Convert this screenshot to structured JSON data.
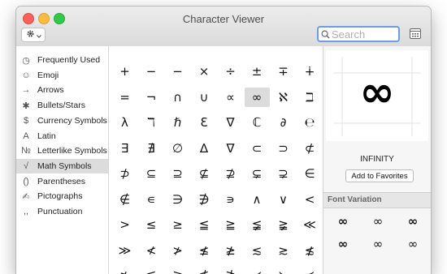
{
  "window": {
    "title": "Character Viewer"
  },
  "toolbar": {
    "search_placeholder": "Search"
  },
  "sidebar": {
    "items": [
      {
        "label": "Frequently Used",
        "icon": "clock-icon",
        "glyph": "◷"
      },
      {
        "label": "Emoji",
        "icon": "smiley-icon",
        "glyph": "☺"
      },
      {
        "label": "Arrows",
        "icon": "arrow-icon",
        "glyph": "→"
      },
      {
        "label": "Bullets/Stars",
        "icon": "asterisk-icon",
        "glyph": "✱"
      },
      {
        "label": "Currency Symbols",
        "icon": "dollar-icon",
        "glyph": "$"
      },
      {
        "label": "Latin",
        "icon": "latin-a-icon",
        "glyph": "A"
      },
      {
        "label": "Letterlike Symbols",
        "icon": "numero-icon",
        "glyph": "№"
      },
      {
        "label": "Math Symbols",
        "icon": "sqrt-icon",
        "glyph": "√"
      },
      {
        "label": "Parentheses",
        "icon": "parentheses-icon",
        "glyph": "()"
      },
      {
        "label": "Pictographs",
        "icon": "pictograph-icon",
        "glyph": "✍"
      },
      {
        "label": "Punctuation",
        "icon": "punctuation-icon",
        "glyph": ",,"
      }
    ],
    "selected_index": 7
  },
  "characters": {
    "rows": [
      [
        "+",
        "−",
        "−",
        "×",
        "÷",
        "±",
        "∓",
        "∔"
      ],
      [
        "=",
        "¬",
        "∩",
        "∪",
        "∝",
        "∞",
        "ℵ",
        "ℶ"
      ],
      [
        "λ",
        "ℸ",
        "ℏ",
        "Ɛ",
        "∇",
        "ℂ",
        "∂",
        "℮"
      ],
      [
        "∃",
        "∄",
        "∅",
        "∆",
        "∇",
        "⊂",
        "⊃",
        "⊄"
      ],
      [
        "⊅",
        "⊆",
        "⊇",
        "⊈",
        "⊉",
        "⊊",
        "⊋",
        "∈"
      ],
      [
        "∉",
        "∊",
        "∋",
        "∌",
        "∍",
        "∧",
        "∨",
        "<"
      ],
      [
        ">",
        "≤",
        "≥",
        "≦",
        "≧",
        "≨",
        "≩",
        "≪"
      ],
      [
        "≫",
        "≮",
        "≯",
        "≰",
        "≱",
        "≲",
        "≳",
        "≴"
      ],
      [
        "≵",
        "≶",
        "≷",
        "≸",
        "≹",
        "≺",
        "≻",
        "≼"
      ]
    ],
    "selected": {
      "row": 1,
      "col": 5
    }
  },
  "detail": {
    "preview_char": "∞",
    "name": "INFINITY",
    "add_favorites_label": "Add to Favorites",
    "font_variation_heading": "Font Variation",
    "variations": [
      "∞",
      "∞",
      "∞",
      "∞",
      "∞",
      "∞"
    ]
  }
}
